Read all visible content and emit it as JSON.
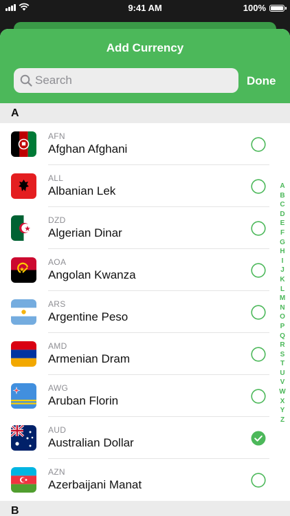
{
  "status_bar": {
    "time": "9:41 AM",
    "battery": "100%"
  },
  "header": {
    "title": "Add Currency",
    "done_label": "Done"
  },
  "search": {
    "placeholder": "Search",
    "value": ""
  },
  "sections": [
    {
      "letter": "A"
    },
    {
      "letter": "B"
    }
  ],
  "currencies": [
    {
      "code": "AFN",
      "name": "Afghan Afghani",
      "selected": false
    },
    {
      "code": "ALL",
      "name": "Albanian Lek",
      "selected": false
    },
    {
      "code": "DZD",
      "name": "Algerian Dinar",
      "selected": false
    },
    {
      "code": "AOA",
      "name": "Angolan Kwanza",
      "selected": false
    },
    {
      "code": "ARS",
      "name": "Argentine Peso",
      "selected": false
    },
    {
      "code": "AMD",
      "name": "Armenian Dram",
      "selected": false
    },
    {
      "code": "AWG",
      "name": "Aruban Florin",
      "selected": false
    },
    {
      "code": "AUD",
      "name": "Australian Dollar",
      "selected": true
    },
    {
      "code": "AZN",
      "name": "Azerbaijani Manat",
      "selected": false
    }
  ],
  "index_letters": [
    "A",
    "B",
    "C",
    "D",
    "E",
    "F",
    "G",
    "H",
    "I",
    "J",
    "K",
    "L",
    "M",
    "N",
    "O",
    "P",
    "Q",
    "R",
    "S",
    "T",
    "U",
    "V",
    "W",
    "X",
    "Y",
    "Z"
  ],
  "colors": {
    "accent": "#4cb85a",
    "accent_dark": "#3a9a47",
    "section_bg": "#ebebeb",
    "circle_gray": "#4cb85a"
  }
}
